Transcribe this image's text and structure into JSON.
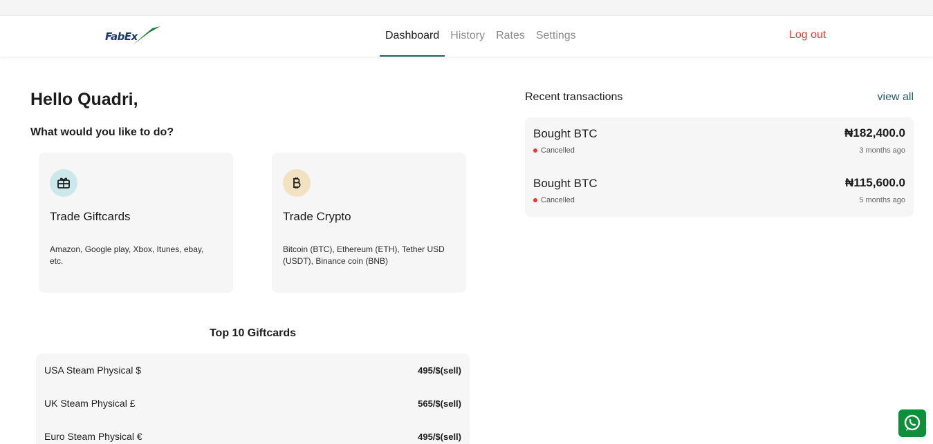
{
  "brand": {
    "logo_text": "FabEx"
  },
  "nav": {
    "items": [
      {
        "label": "Dashboard",
        "active": true
      },
      {
        "label": "History",
        "active": false
      },
      {
        "label": "Rates",
        "active": false
      },
      {
        "label": "Settings",
        "active": false
      }
    ],
    "logout_label": "Log out"
  },
  "main": {
    "greeting": "Hello Quadri,",
    "prompt": "What would you like to do?",
    "cards": [
      {
        "title": "Trade Giftcards",
        "description": "Amazon, Google play, Xbox, Itunes, ebay, etc.",
        "icon": "gift-card-icon"
      },
      {
        "title": "Trade Crypto",
        "description": "Bitcoin (BTC), Ethereum (ETH), Tether USD (USDT), Binance coin (BNB)",
        "icon": "bitcoin-icon"
      }
    ],
    "top10": {
      "title": "Top 10 Giftcards",
      "items": [
        {
          "name": "USA Steam Physical $",
          "rate": "495/$(sell)"
        },
        {
          "name": "UK Steam Physical £",
          "rate": "565/$(sell)"
        },
        {
          "name": "Euro Steam Physical €",
          "rate": "495/$(sell)"
        }
      ]
    }
  },
  "recent": {
    "title": "Recent transactions",
    "view_all": "view all",
    "transactions": [
      {
        "label": "Bought BTC",
        "amount": "₦182,400.0",
        "status": "Cancelled",
        "time": "3 months ago"
      },
      {
        "label": "Bought BTC",
        "amount": "₦115,600.0",
        "status": "Cancelled",
        "time": "5 months ago"
      }
    ]
  },
  "colors": {
    "accent": "#1d5f63",
    "danger": "#e53935",
    "card_bg": "#f6f6f6",
    "whatsapp": "#0f8f3a"
  }
}
